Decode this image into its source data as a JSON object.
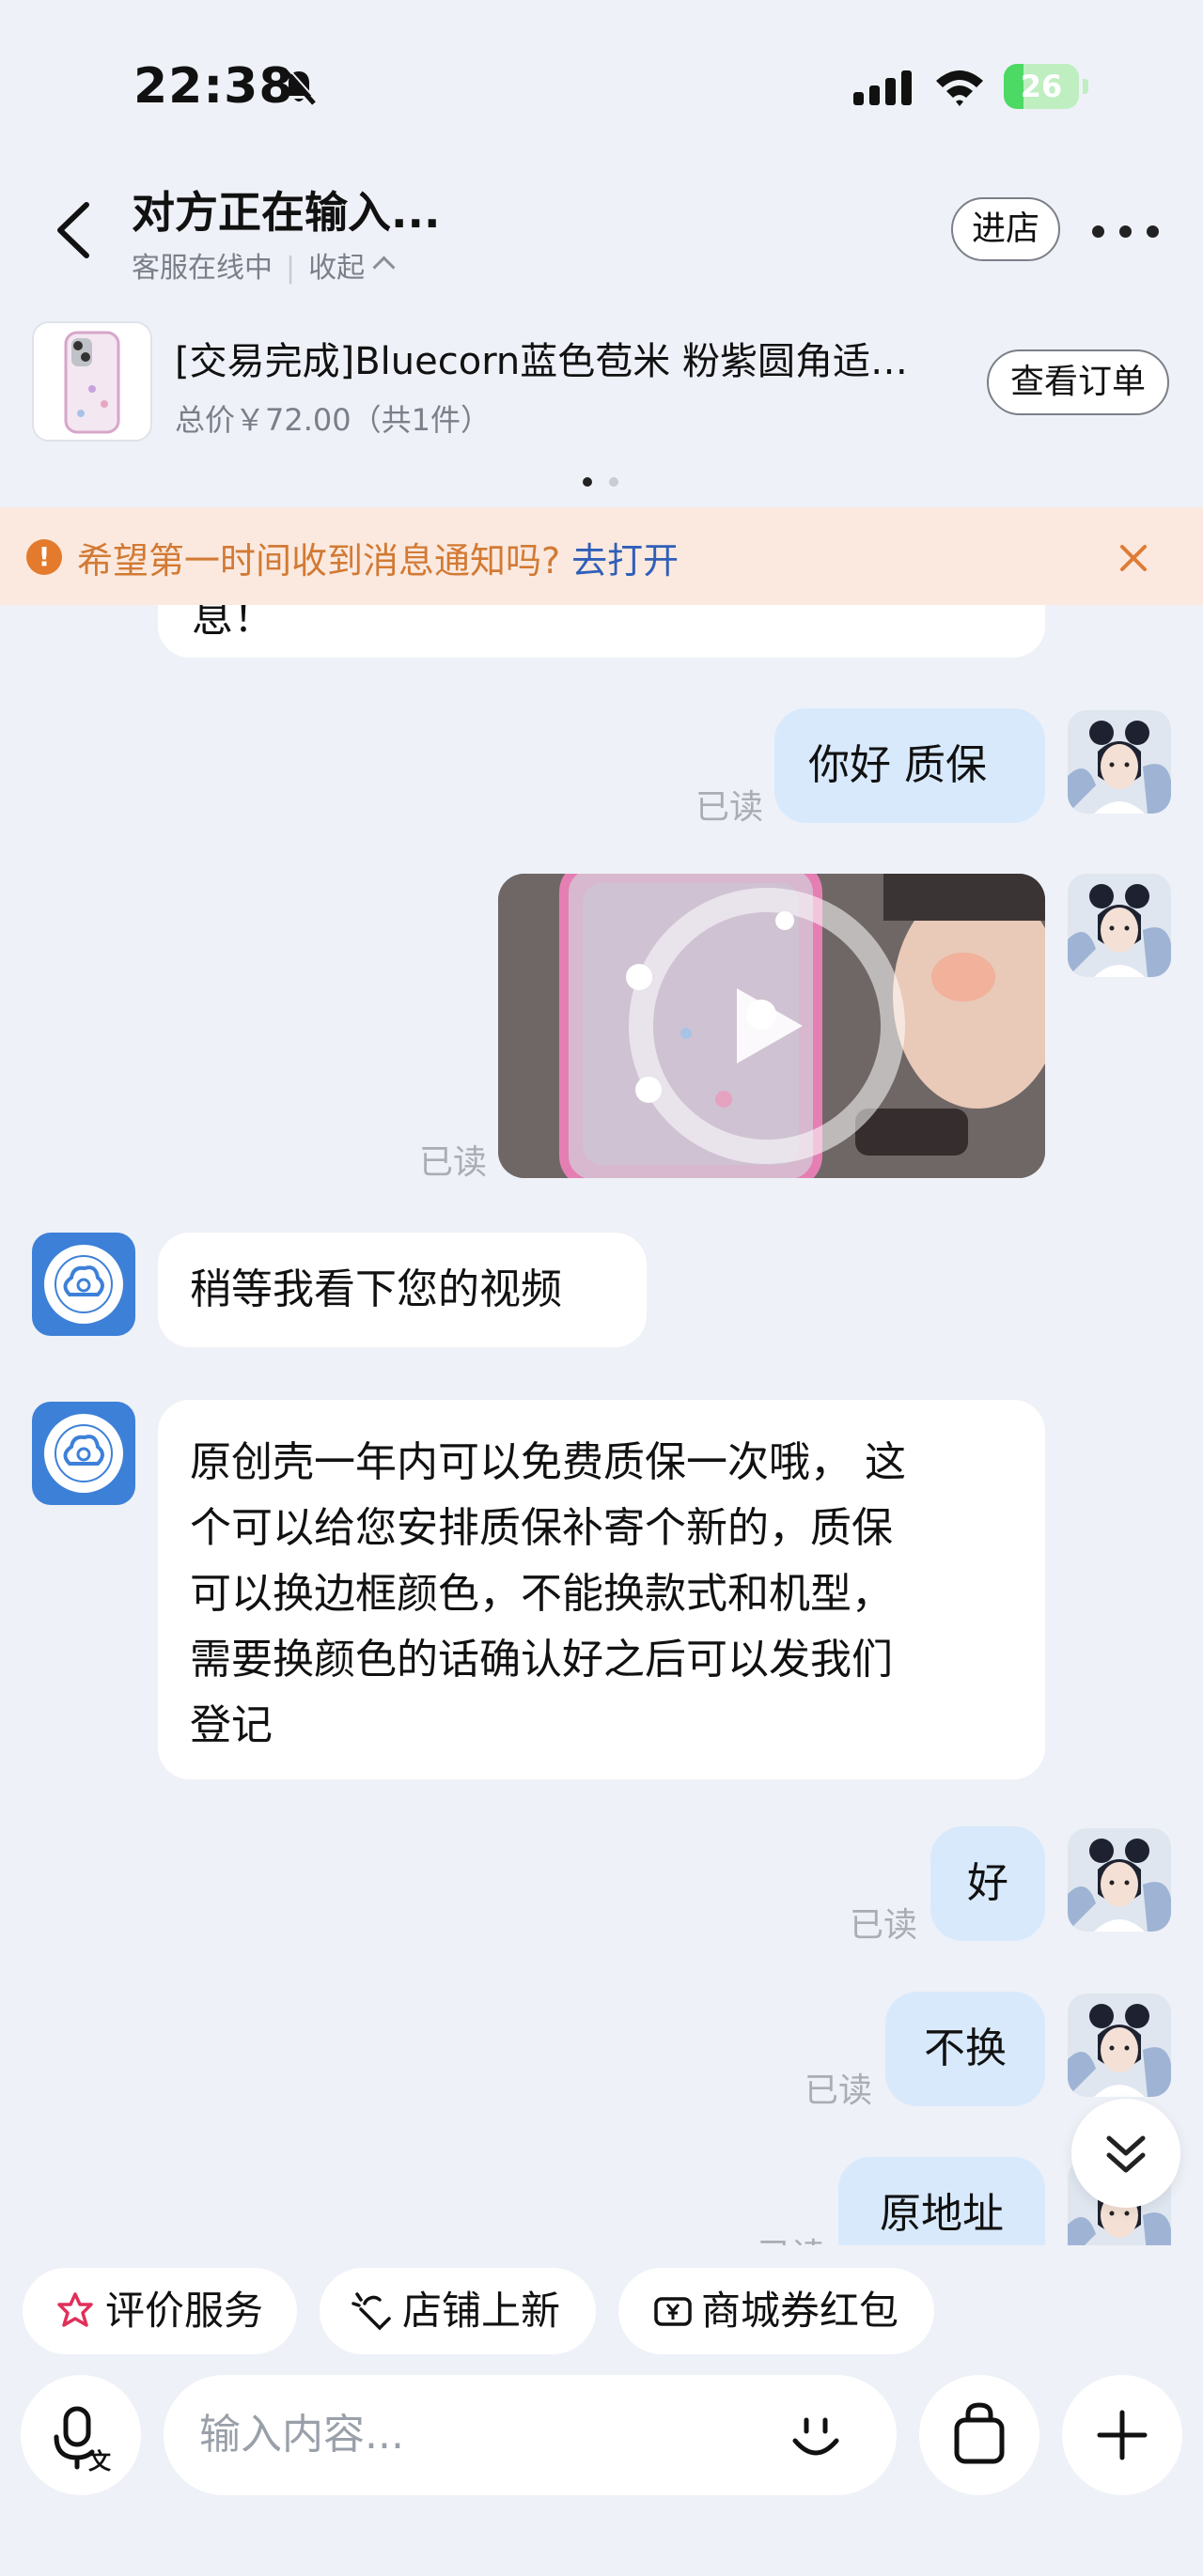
{
  "status_bar": {
    "time": "22:38",
    "battery": "26",
    "battery_level": 0.26
  },
  "header": {
    "title": "对方正在输入...",
    "status": "客服在线中",
    "collapse_label": "收起",
    "store_button": "进店"
  },
  "order": {
    "title": "[交易完成]Bluecorn蓝色苞米 粉紫圆角适…",
    "price": "总价￥72.00（共1件）",
    "view_order_button": "查看订单"
  },
  "notification": {
    "text": "希望第一时间收到消息通知吗?",
    "link": "去打开"
  },
  "messages": [
    {
      "from": "shop",
      "text": "息！"
    },
    {
      "from": "me",
      "text": "你好 质保",
      "read": "已读"
    },
    {
      "from": "me",
      "type": "video",
      "read": "已读"
    },
    {
      "from": "shop",
      "text": "稍等我看下您的视频"
    },
    {
      "from": "shop",
      "lines": [
        "原创壳一年内可以免费质保一次哦， 这",
        "个可以给您安排质保补寄个新的，质保",
        "可以换边框颜色，不能换款式和机型，",
        "需要换颜色的话确认好之后可以发我们",
        "登记"
      ]
    },
    {
      "from": "me",
      "text": "好",
      "read": "已读"
    },
    {
      "from": "me",
      "text": "不换",
      "read": "已读"
    },
    {
      "from": "me",
      "text": "原地址",
      "read": "已读"
    }
  ],
  "quick_actions": [
    "评价服务",
    "店铺上新",
    "商城券红包"
  ],
  "composer": {
    "placeholder": "输入内容..."
  },
  "colors": {
    "accent_blue": "#2f5fb8",
    "bubble_out": "#d8e9fc",
    "notice_bg": "#fbe9df",
    "notice_text": "#d27a34"
  }
}
